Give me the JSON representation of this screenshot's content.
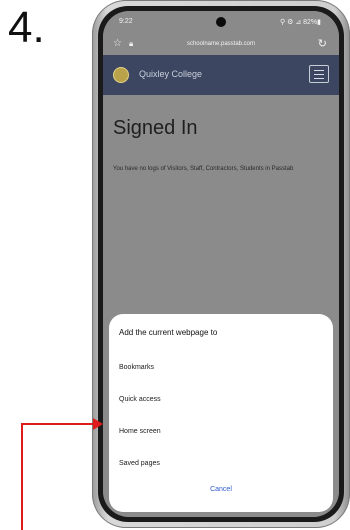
{
  "step_label": "4.",
  "status": {
    "time": "9:22",
    "system": "⚲ ⚙ ⊿ 82%▮"
  },
  "browser": {
    "url": "schoolname.passtab.com"
  },
  "site": {
    "college_name": "Quixley College"
  },
  "page": {
    "title": "Signed In",
    "message": "You have no logs of Visitors, Staff, Contractors, Students in Passtab"
  },
  "sheet": {
    "title": "Add the current webpage to",
    "options": [
      "Bookmarks",
      "Quick access",
      "Home screen",
      "Saved pages"
    ],
    "cancel": "Cancel"
  },
  "colors": {
    "header": "#3c4660",
    "arrow": "#e01b1b",
    "cancel": "#2f5bd0"
  }
}
